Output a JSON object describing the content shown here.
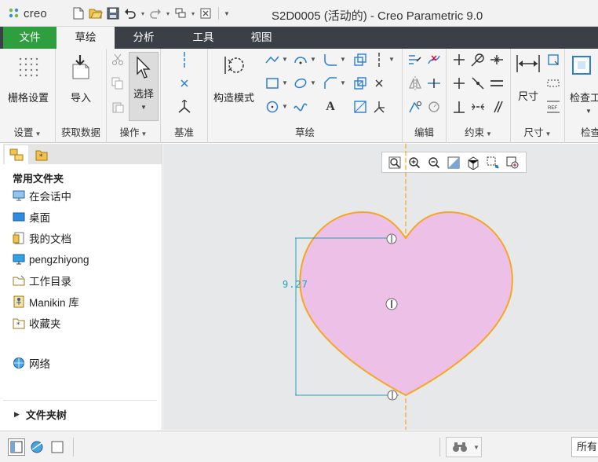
{
  "app": {
    "logo_text": "creo",
    "window_title": "S2D0005 (活动的) - Creo Parametric 9.0"
  },
  "quick_access": {
    "items": [
      "new-icon",
      "open-icon",
      "save-icon",
      "undo-icon",
      "redo-icon",
      "regenerate-icon",
      "close-window-icon",
      "customize-icon"
    ]
  },
  "tabs": [
    {
      "label": "文件"
    },
    {
      "label": "草绘"
    },
    {
      "label": "分析"
    },
    {
      "label": "工具"
    },
    {
      "label": "视图"
    }
  ],
  "ribbon": {
    "groups": {
      "setup": "设置",
      "get_data": "获取数据",
      "operations": "操作",
      "datum": "基准",
      "sketching": "草绘",
      "editing": "编辑",
      "constrain": "约束",
      "dimension": "尺寸",
      "inspect": "检查"
    },
    "buttons": {
      "grid_settings": "栅格设置",
      "import": "导入",
      "select": "选择",
      "construction_mode": "构造模式",
      "dimension": "尺寸",
      "inspect": "检查工"
    }
  },
  "navigator": {
    "heading": "常用文件夹",
    "items": [
      {
        "label": "在会话中",
        "icon": "in-session-icon"
      },
      {
        "label": "桌面",
        "icon": "desktop-icon"
      },
      {
        "label": "我的文档",
        "icon": "my-documents-icon"
      },
      {
        "label": "pengzhiyong",
        "icon": "computer-icon"
      },
      {
        "label": "工作目录",
        "icon": "working-directory-icon"
      },
      {
        "label": "Manikin 库",
        "icon": "manikin-library-icon"
      },
      {
        "label": "收藏夹",
        "icon": "favorites-icon"
      },
      {
        "label": "网络",
        "icon": "network-icon"
      }
    ],
    "folder_tree": "文件夹树"
  },
  "canvas": {
    "dimension_value": "9.27",
    "sketch_fill": "#edc0e8",
    "sketch_stroke": "#f5a623",
    "centerline_color": "#f5a623",
    "dimension_color": "#1fa3b8",
    "background": "#e6e8ea"
  },
  "status": {
    "filter_select": "所有"
  },
  "colors": {
    "file_tab": "#2f9e3f",
    "tab_bar": "#3b3f46",
    "ribbon_bg": "#f4f4f4"
  }
}
